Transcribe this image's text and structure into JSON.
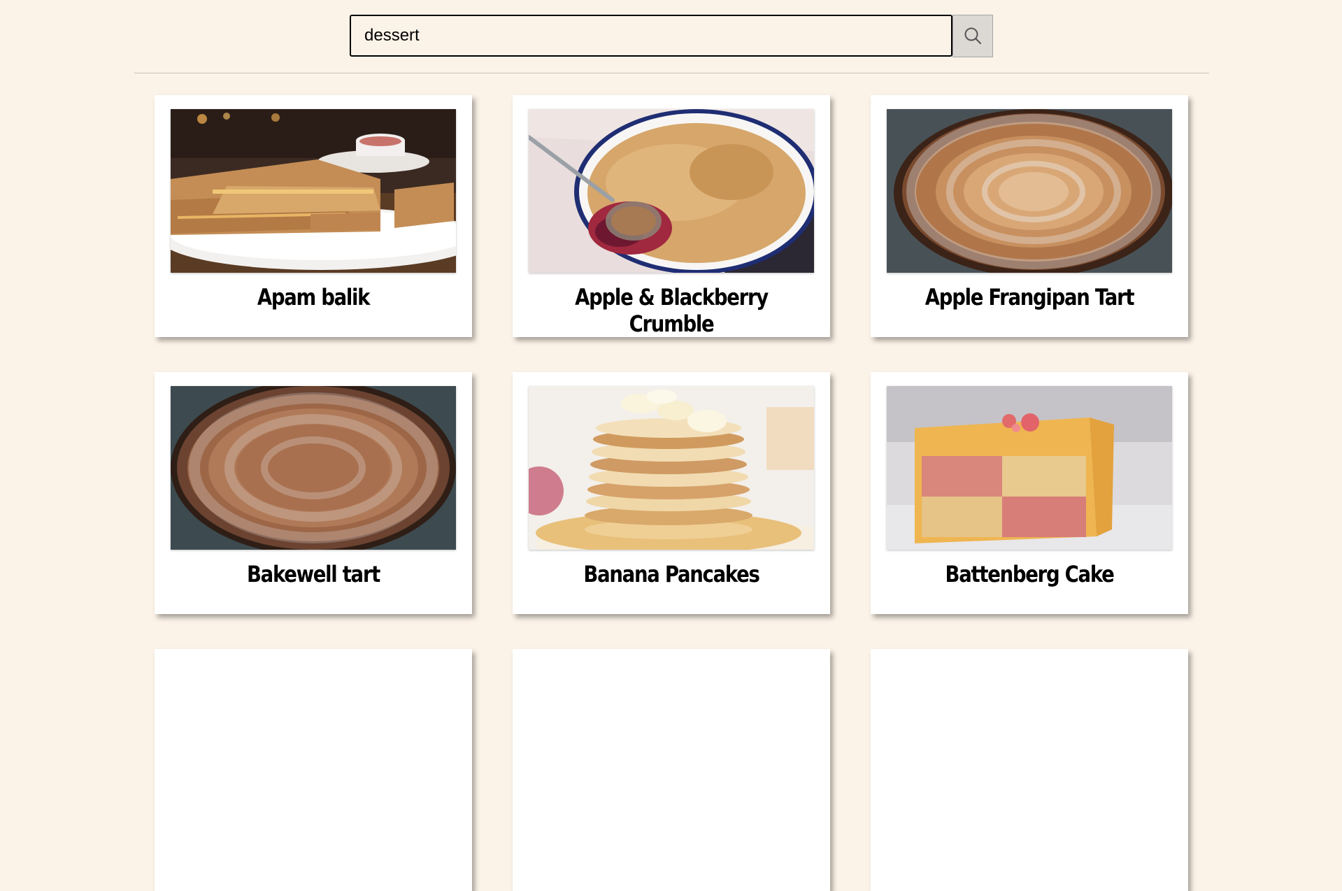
{
  "search": {
    "value": "dessert",
    "button_icon": "search-icon"
  },
  "recipes": [
    {
      "title": "Apam balik"
    },
    {
      "title": "Apple & Blackberry Crumble"
    },
    {
      "title": "Apple Frangipan Tart"
    },
    {
      "title": "Bakewell tart"
    },
    {
      "title": "Banana Pancakes"
    },
    {
      "title": "Battenberg Cake"
    }
  ]
}
